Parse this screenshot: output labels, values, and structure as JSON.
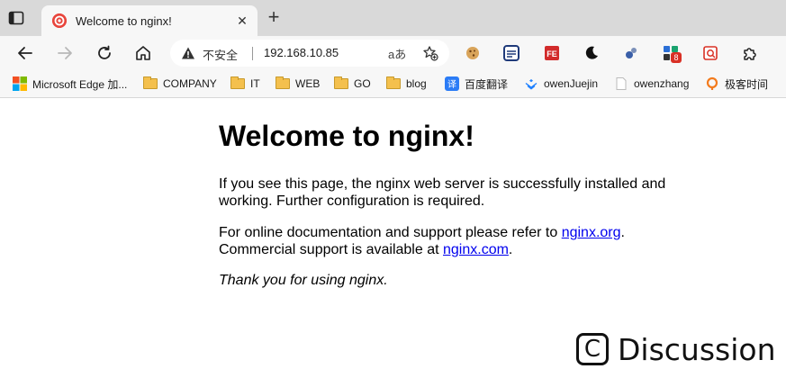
{
  "tab": {
    "title": "Welcome to nginx!",
    "close_glyph": "✕",
    "new_tab_glyph": "+"
  },
  "toolbar": {
    "insecure_label": "不安全",
    "url": "192.168.10.85",
    "read_aloud_glyph": "aあ"
  },
  "extensions": [
    {
      "name": "cookie-extension-icon",
      "badge": ""
    },
    {
      "name": "reader-extension-icon",
      "badge": ""
    },
    {
      "name": "fe-extension-icon",
      "label": "FE"
    },
    {
      "name": "dark-mode-extension-icon"
    },
    {
      "name": "extension-icon-5"
    },
    {
      "name": "extension-icon-6",
      "badge": "8"
    },
    {
      "name": "extension-icon-7"
    },
    {
      "name": "extensions-puzzle-icon"
    }
  ],
  "bookmarks": [
    {
      "label": "Microsoft Edge 加...",
      "icon": "microsoft-icon"
    },
    {
      "label": "COMPANY",
      "icon": "folder-icon"
    },
    {
      "label": "IT",
      "icon": "folder-icon"
    },
    {
      "label": "WEB",
      "icon": "folder-icon"
    },
    {
      "label": "GO",
      "icon": "folder-icon"
    },
    {
      "label": "blog",
      "icon": "folder-icon"
    },
    {
      "label": "百度翻译",
      "icon": "translate-icon"
    },
    {
      "label": "owenJuejin",
      "icon": "juejin-icon"
    },
    {
      "label": "owenzhang",
      "icon": "page-icon"
    },
    {
      "label": "极客时间",
      "icon": "geektime-icon"
    }
  ],
  "page": {
    "heading": "Welcome to nginx!",
    "p1": "If you see this page, the nginx web server is successfully installed and working. Further configuration is required.",
    "p2_prefix": "For online documentation and support please refer to ",
    "p2_link1": "nginx.org",
    "p2_mid": ".",
    "p2_line2_prefix": "Commercial support is available at ",
    "p2_link2": "nginx.com",
    "p2_suffix": ".",
    "p3": "Thank you for using nginx."
  },
  "watermark": {
    "glyph": "C",
    "text": "Discussion"
  },
  "colors": {
    "tabstrip": "#d9d9d9",
    "toolbar": "#f7f7f7",
    "link": "#0000ee",
    "favicon": "#e8453c"
  }
}
